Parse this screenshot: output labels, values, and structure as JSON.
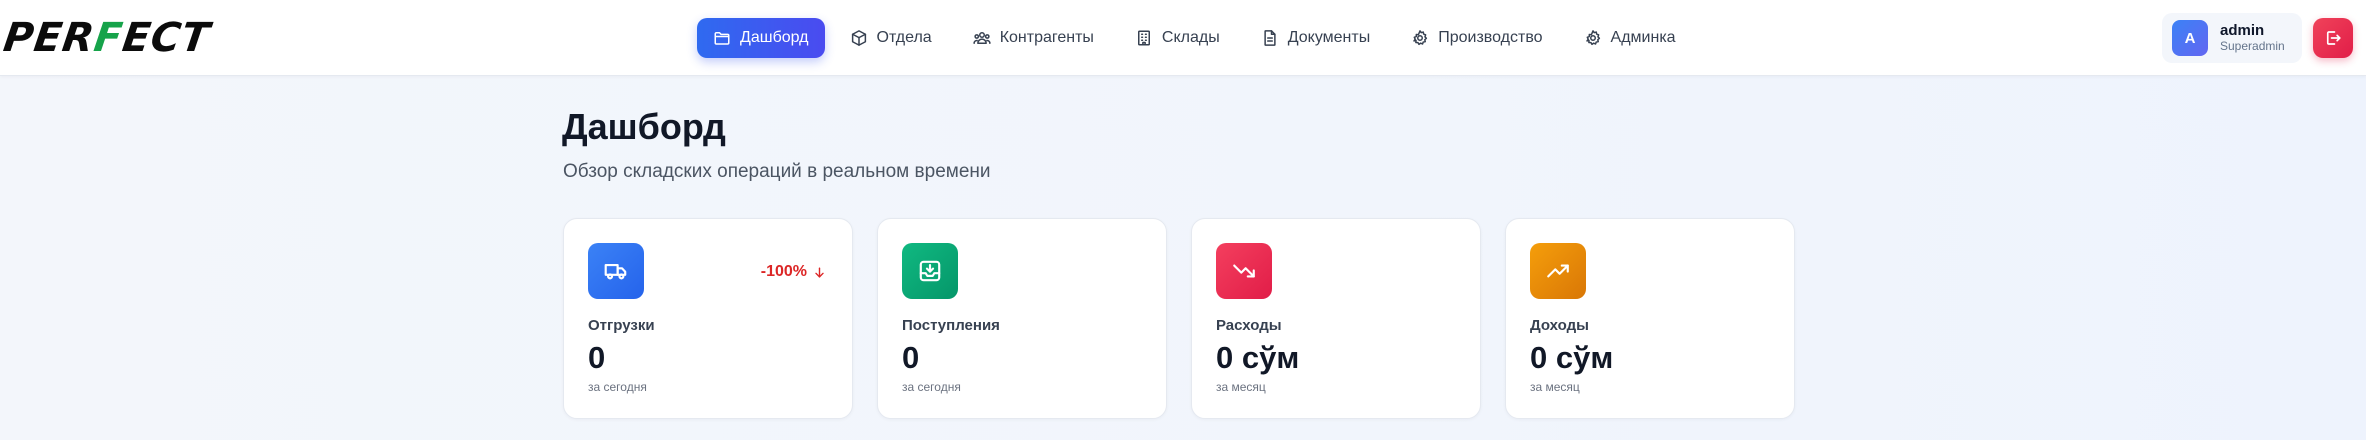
{
  "brand": {
    "logo_part1": "PER",
    "logo_part2": "F",
    "logo_part3": "ECT"
  },
  "nav": {
    "items": [
      {
        "label": "Дашборд",
        "icon": "folder-icon",
        "active": true
      },
      {
        "label": "Отдела",
        "icon": "box-icon"
      },
      {
        "label": "Контрагенты",
        "icon": "users-icon"
      },
      {
        "label": "Склады",
        "icon": "building-icon"
      },
      {
        "label": "Документы",
        "icon": "document-icon"
      },
      {
        "label": "Производство",
        "icon": "cog-icon"
      },
      {
        "label": "Админка",
        "icon": "cog-icon"
      }
    ]
  },
  "user": {
    "initial": "A",
    "name": "admin",
    "role": "Superadmin"
  },
  "logout_icon": "logout-icon",
  "page": {
    "title": "Дашборд",
    "subtitle": "Обзор складских операций в реальном времени"
  },
  "cards": [
    {
      "label": "Отгрузки",
      "value": "0",
      "period": "за сегодня",
      "trend": "-100%",
      "icon": "truck-icon",
      "color_from": "#3b82f6",
      "color_to": "#2563eb"
    },
    {
      "label": "Поступления",
      "value": "0",
      "period": "за сегодня",
      "icon": "inbox-icon",
      "color_from": "#10b981",
      "color_to": "#059669"
    },
    {
      "label": "Расходы",
      "value": "0 сўм",
      "period": "за месяц",
      "icon": "trending-down-icon",
      "color_from": "#f43f5e",
      "color_to": "#e11d48"
    },
    {
      "label": "Доходы",
      "value": "0 сўм",
      "period": "за месяц",
      "icon": "trending-up-icon",
      "color_from": "#f59e0b",
      "color_to": "#d97706"
    }
  ],
  "colors": {
    "accent": "#3b5bf0",
    "danger": "#e11d48",
    "trend_negative": "#dc2626"
  }
}
